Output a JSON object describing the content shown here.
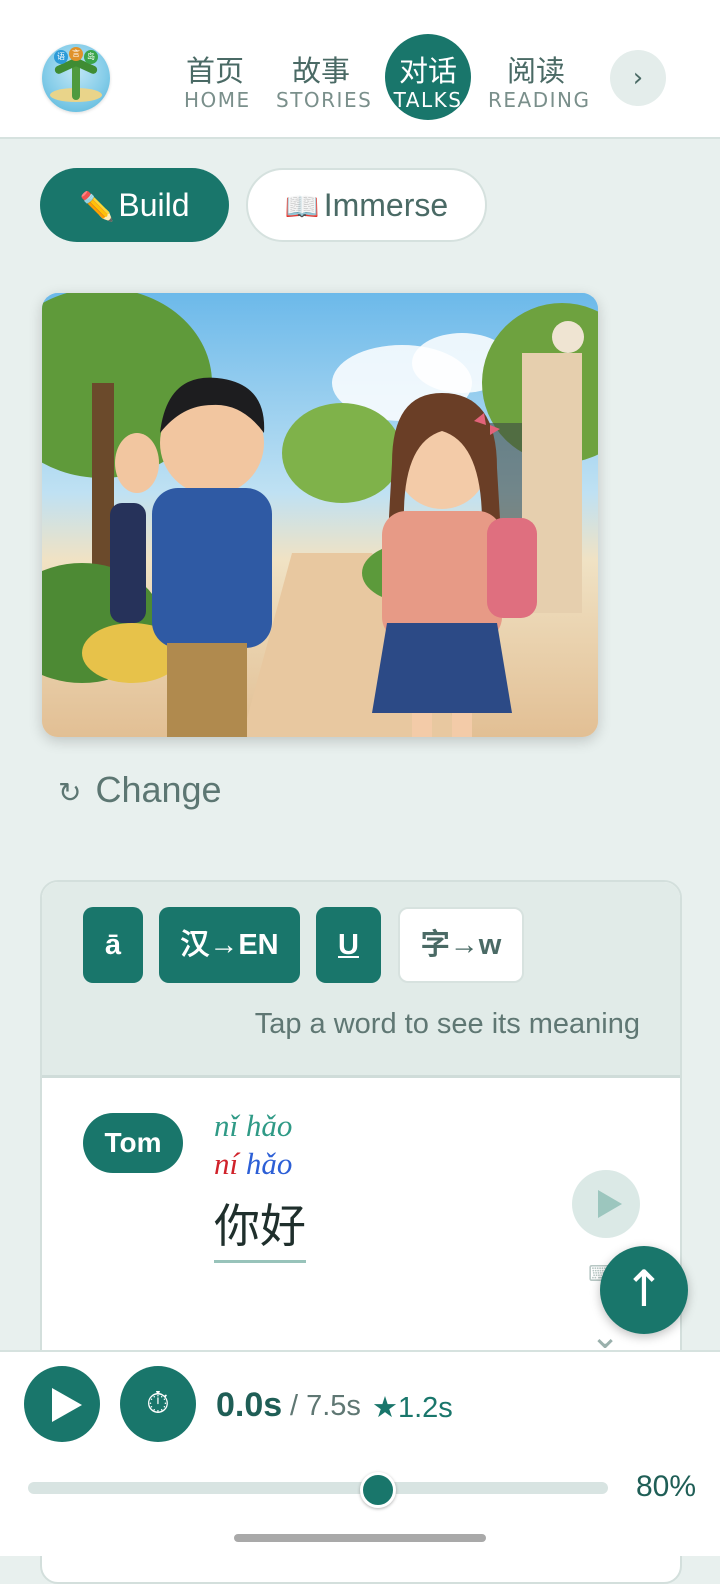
{
  "header": {
    "nav": [
      {
        "zh": "首页",
        "en": "HOME"
      },
      {
        "zh": "故事",
        "en": "STORIES"
      },
      {
        "zh": "对话",
        "en": "TALKS",
        "active": true
      },
      {
        "zh": "阅读",
        "en": "READING"
      }
    ],
    "more_glyph": "›",
    "logo_badges": [
      "语",
      "言",
      "岛"
    ]
  },
  "modes": {
    "build_icon": "✏️",
    "build_label": "Build",
    "immerse_icon": "📖",
    "immerse_label": "Immerse"
  },
  "scene": {
    "change_icon": "↻",
    "change_label": "Change"
  },
  "toolbar": {
    "tone_mark": "ā",
    "translate": "汉→EN",
    "underline": "U",
    "char_to_word": "字→w",
    "hint": "Tap a word to see its meaning"
  },
  "dialogue": {
    "speaker": "Tom",
    "pinyin_marked": "nǐ hǎo",
    "pinyin_spoken": [
      "ní",
      "hǎo"
    ],
    "hanzi": "你好",
    "chevron": "⌄"
  },
  "fab": {
    "glyph": "↑"
  },
  "player": {
    "timer_icon": "⏱",
    "time_now": "0.0s",
    "time_total": "/ 7.5s",
    "time_best": "★1.2s",
    "speed": "80%",
    "progress": 0.6
  },
  "colors": {
    "accent": "#19766b",
    "tone2": "#d0222a",
    "tone3": "#2c5fd6"
  }
}
